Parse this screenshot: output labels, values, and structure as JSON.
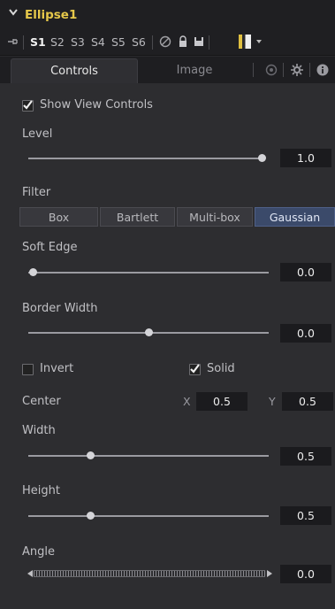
{
  "header": {
    "title": "Ellipse1"
  },
  "toolbar": {
    "slots": [
      "S1",
      "S2",
      "S3",
      "S4",
      "S5",
      "S6"
    ],
    "active_slot": "S1",
    "swatch_colors": [
      "#e0c040",
      "#2a2a2a",
      "#f0f0f0"
    ]
  },
  "tabs": {
    "controls": "Controls",
    "image": "Image"
  },
  "controls": {
    "show_view_controls": {
      "label": "Show View Controls",
      "checked": true
    },
    "level": {
      "label": "Level",
      "value": "1.0",
      "slider_fraction": 1.0
    },
    "filter": {
      "label": "Filter",
      "options": [
        "Box",
        "Bartlett",
        "Multi-box",
        "Gaussian"
      ],
      "selected": "Gaussian"
    },
    "soft_edge": {
      "label": "Soft Edge",
      "value": "0.0",
      "slider_fraction": 0.0
    },
    "border_width": {
      "label": "Border Width",
      "value": "0.0",
      "slider_fraction": 0.5
    },
    "invert": {
      "label": "Invert",
      "checked": false
    },
    "solid": {
      "label": "Solid",
      "checked": true
    },
    "center": {
      "label": "Center",
      "x_label": "X",
      "x_value": "0.5",
      "y_label": "Y",
      "y_value": "0.5"
    },
    "width": {
      "label": "Width",
      "value": "0.5",
      "slider_fraction": 0.25
    },
    "height": {
      "label": "Height",
      "value": "0.5",
      "slider_fraction": 0.25
    },
    "angle": {
      "label": "Angle",
      "value": "0.0"
    }
  },
  "colors": {
    "title": "#e6c84a",
    "selected_button": "#3b4a6a",
    "panel": "#2d2d30"
  }
}
